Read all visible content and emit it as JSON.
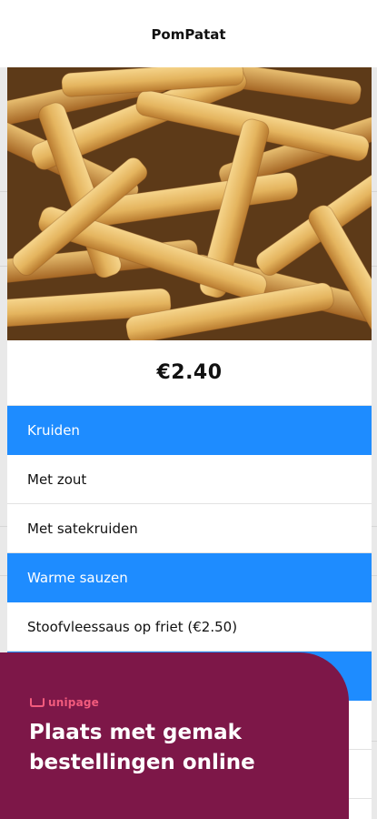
{
  "app": {
    "title": "PomPatat"
  },
  "product": {
    "image_alt": "Patat",
    "price": "€2.40"
  },
  "sections": [
    {
      "header": "Kruiden",
      "options": [
        "Met zout",
        "Met satekruiden"
      ]
    },
    {
      "header": "Warme sauzen",
      "options": [
        "Stoofvleessaus op friet (€2.50)"
      ]
    }
  ],
  "promo": {
    "brand": "unipage",
    "text": "Plaats met gemak bestellingen online",
    "background_color": "#7d1748",
    "brand_color": "#f25b7d"
  },
  "colors": {
    "section_header": "#1e8cff"
  }
}
